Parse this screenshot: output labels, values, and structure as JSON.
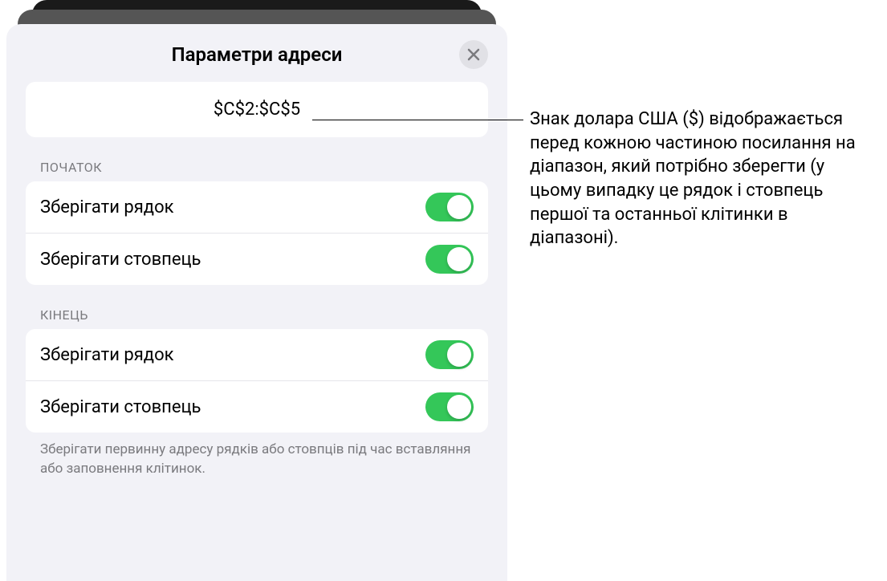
{
  "panel": {
    "title": "Параметри адреси",
    "range_value": "$C$2:$C$5",
    "start": {
      "label": "ПОЧАТОК",
      "preserve_row": "Зберігати рядок",
      "preserve_column": "Зберігати стовпець"
    },
    "end": {
      "label": "КІНЕЦЬ",
      "preserve_row": "Зберігати рядок",
      "preserve_column": "Зберігати стовпець"
    },
    "footer": "Зберігати первинну адресу рядків або стовпців під час вставляння або заповнення клітинок."
  },
  "callout": {
    "text": "Знак долара США ($) відображається перед кожною частиною посилання на діапазон, який потрібно зберегти (у цьому випадку це рядок і стовпець першої та останньої клітинки в діапазоні)."
  }
}
